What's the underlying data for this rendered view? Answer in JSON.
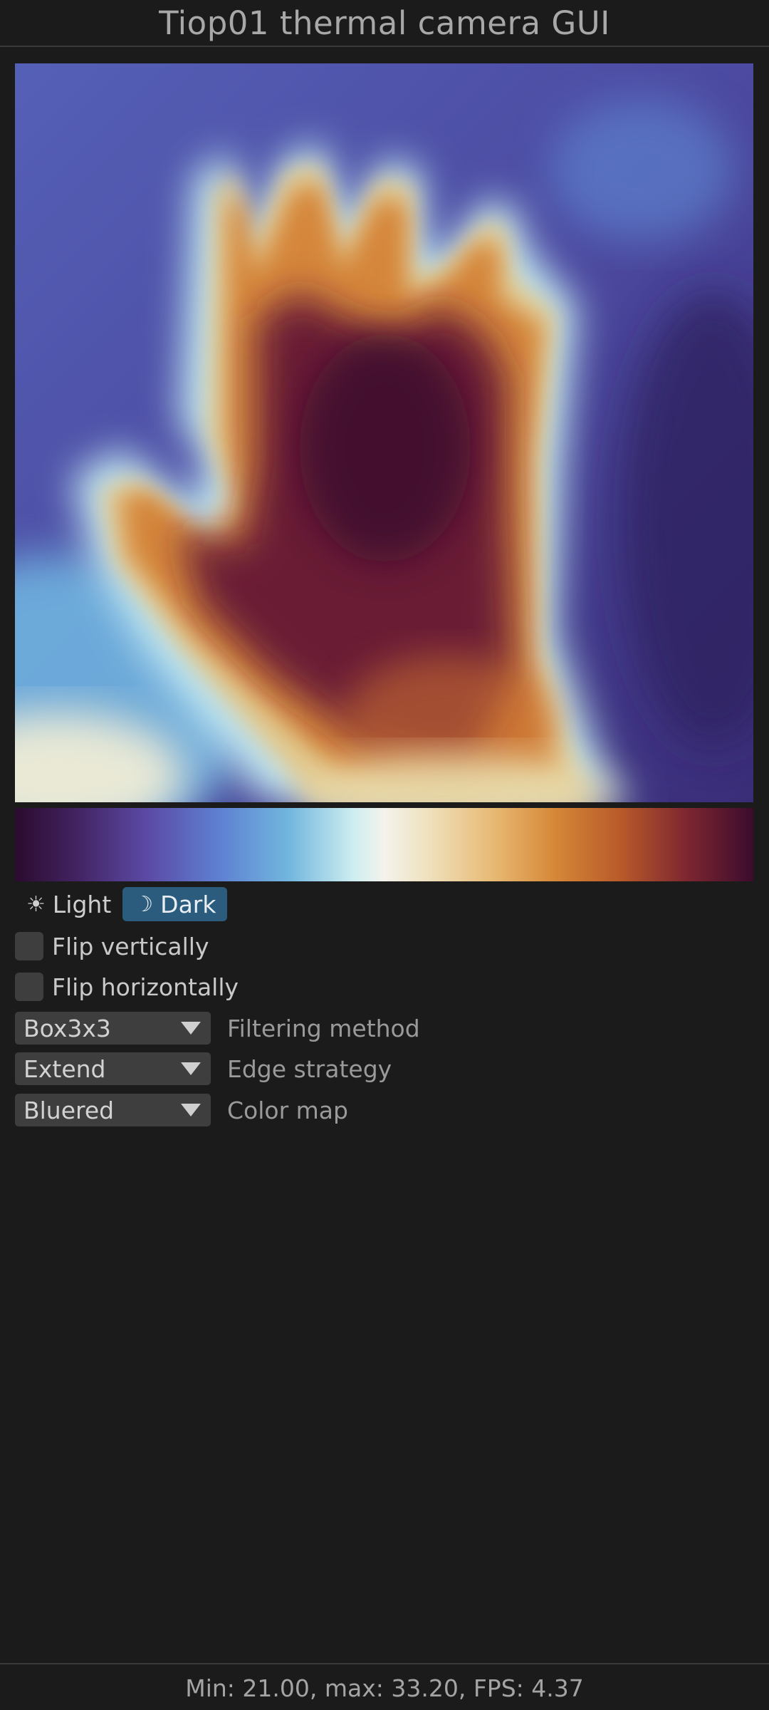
{
  "app": {
    "title": "Tiop01 thermal camera GUI"
  },
  "theme": {
    "light_label": "Light",
    "dark_label": "Dark",
    "light_icon": "sun-icon",
    "dark_icon": "moon-icon",
    "selected": "Dark"
  },
  "options": {
    "flip_vertically": {
      "label": "Flip vertically",
      "checked": false
    },
    "flip_horizontally": {
      "label": "Flip horizontally",
      "checked": false
    }
  },
  "combos": {
    "filtering": {
      "value": "Box3x3",
      "label": "Filtering method"
    },
    "edge": {
      "value": "Extend",
      "label": "Edge strategy"
    },
    "colormap": {
      "value": "Bluered",
      "label": "Color map"
    }
  },
  "status": {
    "text": "Min: 21.00, max: 33.20, FPS: 4.37"
  },
  "colors": {
    "background": "#1b1b1b",
    "accent": "#2b5b7d",
    "widget": "#3e3e3e"
  }
}
